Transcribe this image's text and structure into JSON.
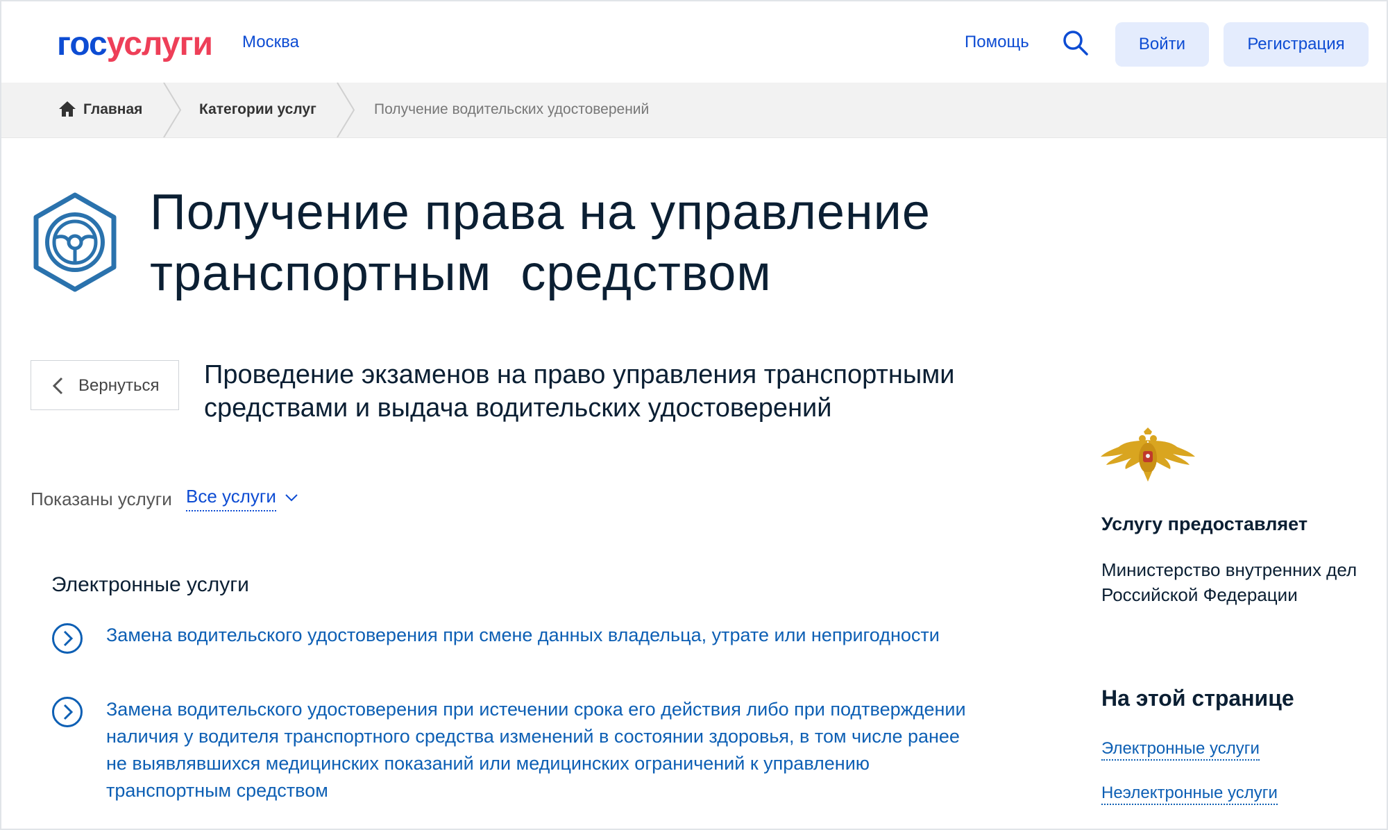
{
  "header": {
    "logo_part1": "гос",
    "logo_part2": "услуги",
    "city": "Москва",
    "help": "Помощь",
    "login": "Войти",
    "register": "Регистрация"
  },
  "breadcrumbs": {
    "home": "Главная",
    "categories": "Категории услуг",
    "current": "Получение водительских удостоверений"
  },
  "main": {
    "title_line1": "Получение права на управление",
    "title_line2": "транспортным  средством",
    "back_label": "Вернуться",
    "subtitle_line1": "Проведение экзаменов на право управления транспортными",
    "subtitle_line2": "средствами и выдача водительских удостоверений",
    "filter_label": "Показаны услуги",
    "filter_value": "Все услуги",
    "section_title": "Электронные услуги",
    "services": [
      {
        "lines": [
          "Замена водительского удостоверения при смене данных владельца, утрате или непригодности"
        ]
      },
      {
        "lines": [
          "Замена водительского удостоверения при истечении срока его действия либо при подтверждении",
          "наличия у водителя транспортного средства изменений в состоянии здоровья, в том числе ранее",
          "не выявлявшихся медицинских показаний или медицинских ограничений к управлению",
          "транспортным средством"
        ]
      }
    ]
  },
  "sidebar": {
    "provider_title": "Услугу предоставляет",
    "provider_line1": "Министерство внутренних дел",
    "provider_line2": "Российской Федерации",
    "on_page_title": "На этой странице",
    "links": [
      "Электронные услуги",
      "Неэлектронные услуги"
    ]
  },
  "colors": {
    "brand_blue": "#0d4cd3",
    "brand_red": "#ee3f58",
    "link_blue": "#0d5fb4",
    "icon_blue": "#2a72ad"
  }
}
